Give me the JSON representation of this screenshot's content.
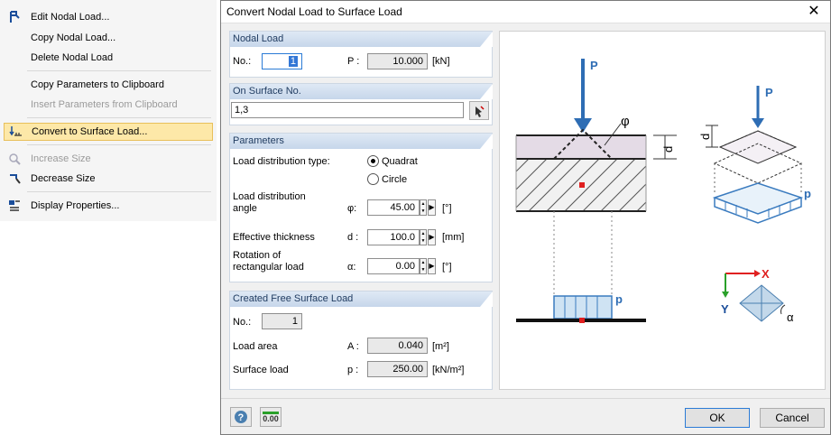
{
  "context_menu": {
    "items": [
      {
        "label": "Edit Nodal Load...",
        "icon": "edit-load-icon",
        "enabled": true,
        "selected": false
      },
      {
        "label": "Copy Nodal Load...",
        "icon": "",
        "enabled": true,
        "selected": false
      },
      {
        "label": "Delete Nodal Load",
        "icon": "",
        "enabled": true,
        "selected": false
      },
      {
        "label": "Copy Parameters to Clipboard",
        "icon": "",
        "enabled": true,
        "selected": false
      },
      {
        "label": "Insert Parameters from Clipboard",
        "icon": "",
        "enabled": false,
        "selected": false
      },
      {
        "label": "Convert to Surface Load...",
        "icon": "convert-load-icon",
        "enabled": true,
        "selected": true
      },
      {
        "label": "Increase Size",
        "icon": "increase-size-icon",
        "enabled": false,
        "selected": false
      },
      {
        "label": "Decrease Size",
        "icon": "decrease-size-icon",
        "enabled": true,
        "selected": false
      },
      {
        "label": "Display Properties...",
        "icon": "display-properties-icon",
        "enabled": true,
        "selected": false
      }
    ]
  },
  "dialog": {
    "title": "Convert Nodal Load to Surface Load",
    "nodal_load": {
      "header": "Nodal Load",
      "no_label": "No.:",
      "no_value": "1",
      "p_label": "P :",
      "p_value": "10.000",
      "p_unit": "[kN]"
    },
    "surface": {
      "header": "On Surface No.",
      "value": "1,3"
    },
    "parameters": {
      "header": "Parameters",
      "dist_type_label": "Load distribution type:",
      "option_quadrat": "Quadrat",
      "option_circle": "Circle",
      "selected_option": "Quadrat",
      "angle_label_1": "Load distribution",
      "angle_label_2": "angle",
      "angle_symbol": "φ:",
      "angle_value": "45.00",
      "angle_unit": "[°]",
      "thickness_label": "Effective thickness",
      "thickness_symbol": "d :",
      "thickness_value": "100.0",
      "thickness_unit": "[mm]",
      "rotation_label_1": "Rotation of",
      "rotation_label_2": "rectangular load",
      "rotation_symbol": "α:",
      "rotation_value": "0.00",
      "rotation_unit": "[°]"
    },
    "created": {
      "header": "Created Free Surface Load",
      "no_label": "No.:",
      "no_value": "1",
      "area_label": "Load area",
      "area_symbol": "A :",
      "area_value": "0.040",
      "area_unit": "[m²]",
      "load_label": "Surface load",
      "load_symbol": "p :",
      "load_value": "250.00",
      "load_unit": "[kN/m²]"
    },
    "diagram": {
      "label_P": "P",
      "label_P2": "P",
      "label_phi": "φ",
      "label_d": "d",
      "label_d2": "d",
      "label_p": "p",
      "label_p2": "p",
      "label_x": "X",
      "label_y": "Y",
      "label_alpha": "α"
    },
    "buttons": {
      "ok": "OK",
      "cancel": "Cancel",
      "help_icon": "help-icon",
      "units_icon": "units-icon",
      "units_text": "0.00"
    }
  }
}
